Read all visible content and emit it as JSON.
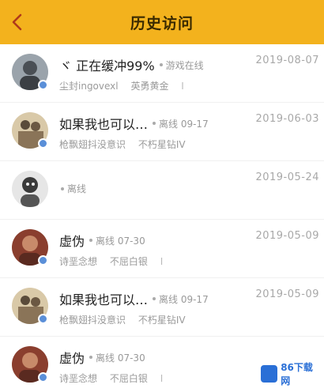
{
  "header": {
    "title": "历史访问",
    "back_icon": "chevron-left-icon"
  },
  "colors": {
    "accent": "#f3b21d",
    "badge": "#5a8fd8"
  },
  "list": [
    {
      "name": "ヾ 正在缓冲99%",
      "status": "游戏在线",
      "date": "2019-08-07",
      "sub1": "尘封ingovexl",
      "sub2": "英勇黄金",
      "bar": "I"
    },
    {
      "name": "如果我也可以…",
      "status": "离线 09-17",
      "date": "2019-06-03",
      "sub1": "枪飘翅抖没意识",
      "sub2": "不朽星钻IV",
      "bar": ""
    },
    {
      "name": "",
      "status": "离线",
      "date": "2019-05-24",
      "sub1": "",
      "sub2": "",
      "bar": ""
    },
    {
      "name": "虚伪",
      "status": "离线 07-30",
      "date": "2019-05-09",
      "sub1": "诗垩念想",
      "sub2": "不屈白银",
      "bar": "I"
    },
    {
      "name": "如果我也可以…",
      "status": "离线 09-17",
      "date": "2019-05-09",
      "sub1": "枪飘翅抖没意识",
      "sub2": "不朽星钻IV",
      "bar": ""
    },
    {
      "name": "虚伪",
      "status": "离线 07-30",
      "date": "",
      "sub1": "诗垩念想",
      "sub2": "不屈白银",
      "bar": "I"
    }
  ],
  "watermark": {
    "text": "86下载网"
  }
}
